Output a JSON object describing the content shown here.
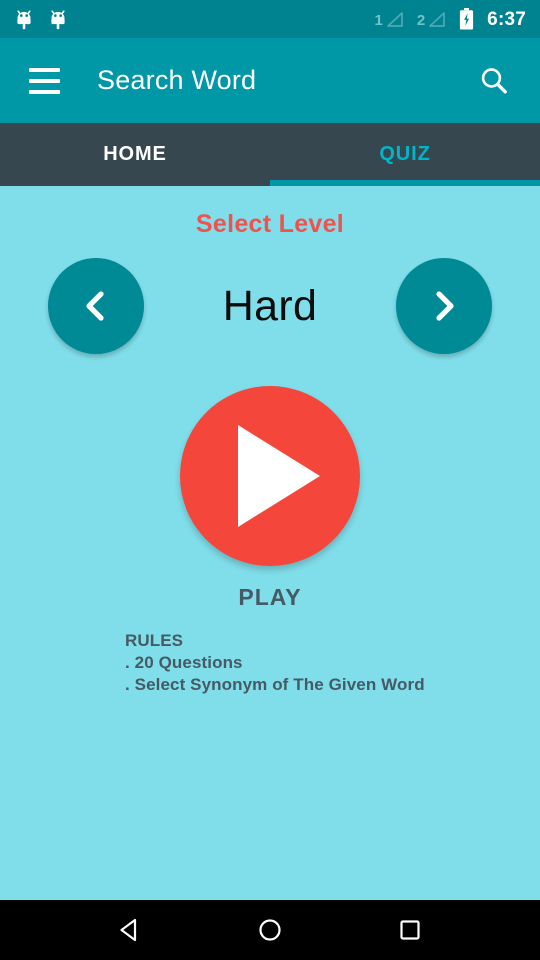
{
  "status_bar": {
    "notification_icons": [
      "bugdroid-icon",
      "bugdroid-icon"
    ],
    "sim1_label": "1",
    "sim2_label": "2",
    "signal_icon": "signal-triangle-icon",
    "battery_icon": "battery-charging-icon",
    "time": "6:37",
    "background_color": "#008391"
  },
  "app_bar": {
    "menu_icon": "hamburger-menu-icon",
    "title": "Search Word",
    "search_icon": "search-icon",
    "background_color": "#0097a7"
  },
  "tabs": {
    "background_color": "#37474f",
    "active_color": "#00b5c8",
    "indicator_color": "#0097a7",
    "items": [
      {
        "label": "HOME",
        "active": false
      },
      {
        "label": "QUIZ",
        "active": true
      }
    ]
  },
  "content": {
    "background_color": "#80deea",
    "select_level_title": "Select Level",
    "select_level_color": "#ef5350",
    "prev_icon": "chevron-left-icon",
    "next_icon": "chevron-right-icon",
    "level_name": "Hard",
    "nav_circle_color": "#008a96",
    "play_icon": "play-triangle-icon",
    "play_button_color": "#f4463a",
    "play_label": "PLAY",
    "rules": {
      "heading": "RULES",
      "lines": [
        ". 20 Questions",
        ". Select Synonym of The Given Word"
      ]
    }
  },
  "nav_bar": {
    "background_color": "#000000",
    "back_icon": "back-triangle-icon",
    "home_icon": "home-circle-icon",
    "recents_icon": "recents-square-icon"
  }
}
